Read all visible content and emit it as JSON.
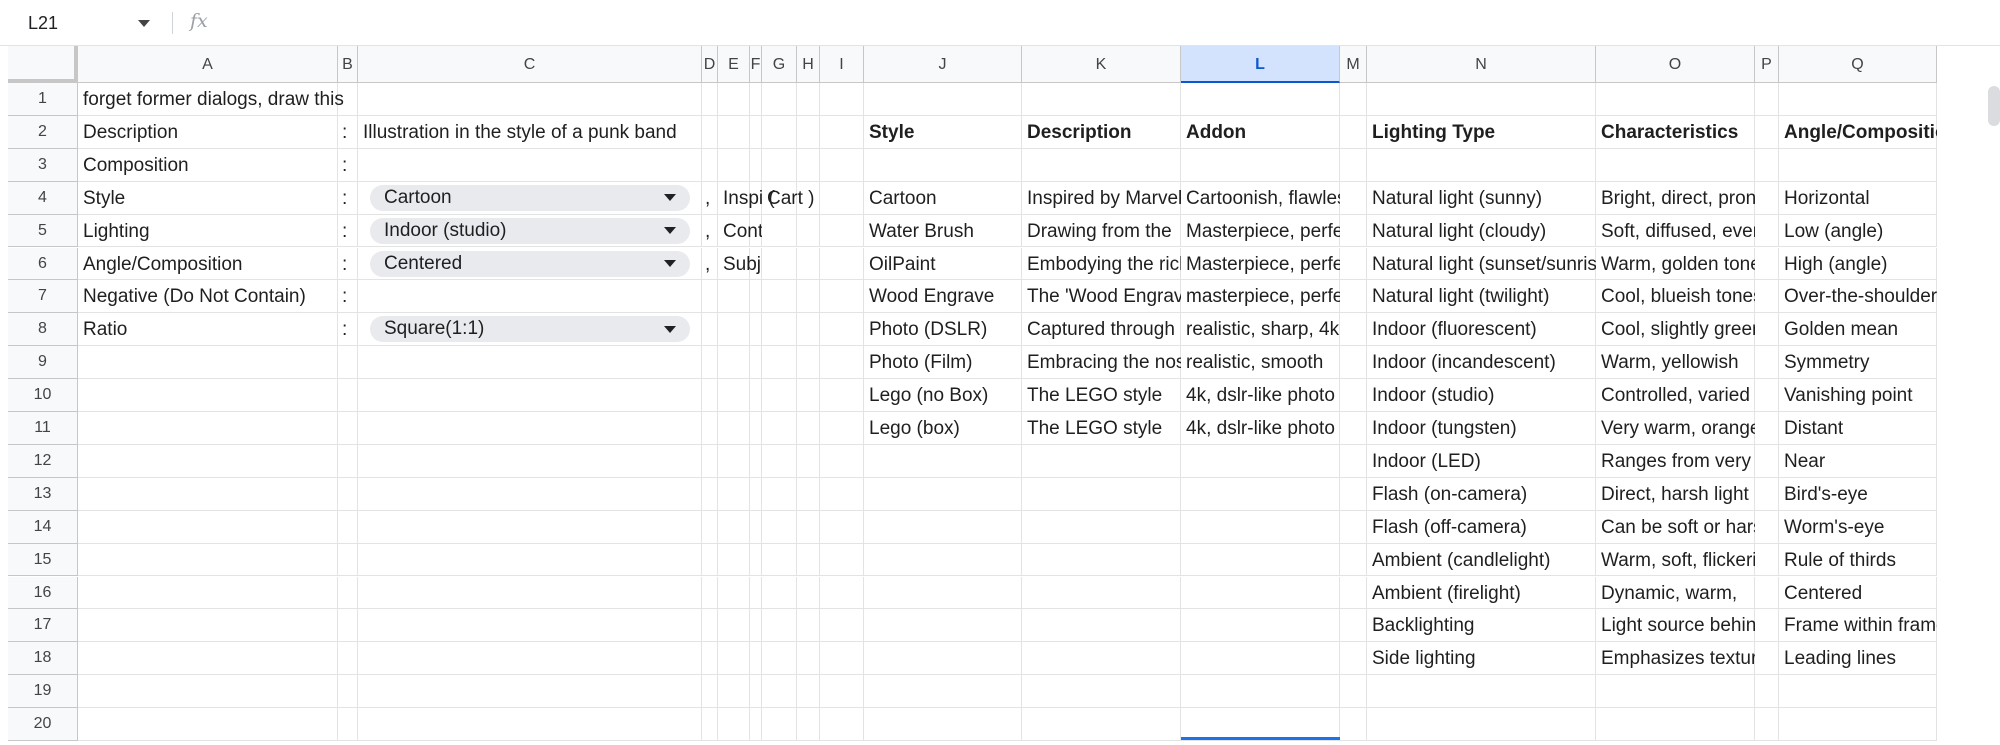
{
  "formula_bar": {
    "cell_ref": "L21",
    "fx_label": "fx",
    "value": ""
  },
  "columns": [
    "A",
    "B",
    "C",
    "D",
    "E",
    "F",
    "G",
    "H",
    "I",
    "J",
    "K",
    "L",
    "M",
    "N",
    "O",
    "P",
    "Q"
  ],
  "selected_column": "L",
  "rows": [
    "1",
    "2",
    "3",
    "4",
    "5",
    "6",
    "7",
    "8",
    "9",
    "10",
    "11",
    "12",
    "13",
    "14",
    "15",
    "16",
    "17",
    "18",
    "19",
    "20"
  ],
  "form": {
    "a1": "forget former dialogs, draw this",
    "labels": [
      "Description",
      "Composition",
      "Style",
      "Lighting",
      "Angle/Composition",
      "Negative (Do Not Contain)",
      "Ratio"
    ],
    "colon": ":",
    "description_value": "Illustration in the style of a punk band",
    "style_value": "Cartoon",
    "lighting_value": "Indoor (studio)",
    "angle_value": "Centered",
    "ratio_value": "Square(1:1)",
    "comma": ",",
    "e4": "Inspi (",
    "g4": "Cart )",
    "e5": "Cont",
    "e6": "Subj"
  },
  "style_table": {
    "headers": [
      "Style",
      "Description",
      "Addon"
    ],
    "rows": [
      [
        "Cartoon",
        "Inspired by Marvel",
        "Cartoonish, flawless"
      ],
      [
        "Water Brush",
        "Drawing from the",
        "Masterpiece, perfect"
      ],
      [
        "OilPaint",
        "Embodying the rich",
        "Masterpiece, perfect"
      ],
      [
        "Wood Engrave",
        "The 'Wood Engraving",
        "masterpiece, perfect"
      ],
      [
        "Photo (DSLR)",
        "Captured through",
        "realistic, sharp, 4k"
      ],
      [
        "Photo (Film)",
        "Embracing the nostalgic",
        "realistic, smooth"
      ],
      [
        "Lego (no Box)",
        "The LEGO style",
        "4k, dslr-like photo"
      ],
      [
        "Lego (box)",
        "The LEGO style",
        "4k, dslr-like photo"
      ]
    ]
  },
  "lighting_table": {
    "headers": [
      "Lighting Type",
      "Characteristics",
      "Angle/Composition"
    ],
    "rows": [
      [
        "Natural light (sunny)",
        "Bright, direct, pronounced",
        "Horizontal"
      ],
      [
        "Natural light (cloudy)",
        "Soft, diffused, even",
        "Low (angle)"
      ],
      [
        "Natural light (sunset/sunrise)",
        "Warm, golden tones",
        "High (angle)"
      ],
      [
        "Natural light (twilight)",
        "Cool, blueish tones",
        "Over-the-shoulder"
      ],
      [
        "Indoor (fluorescent)",
        "Cool, slightly greenish",
        "Golden mean"
      ],
      [
        "Indoor (incandescent)",
        "Warm, yellowish",
        "Symmetry"
      ],
      [
        "Indoor (studio)",
        "Controlled, varied",
        "Vanishing point"
      ],
      [
        "Indoor (tungsten)",
        "Very warm, orange",
        "Distant"
      ],
      [
        "Indoor (LED)",
        "Ranges from very",
        "Near"
      ],
      [
        "Flash (on-camera)",
        "Direct, harsh light",
        "Bird's-eye"
      ],
      [
        "Flash (off-camera)",
        "Can be soft or harsh",
        "Worm's-eye"
      ],
      [
        "Ambient (candlelight)",
        "Warm, soft, flickering",
        "Rule of thirds"
      ],
      [
        "Ambient (firelight)",
        "Dynamic, warm,",
        "Centered"
      ],
      [
        "Backlighting",
        "Light source behind",
        "Frame within frame"
      ],
      [
        "Side lighting",
        "Emphasizes texture",
        "Leading lines"
      ]
    ]
  },
  "colors": {
    "selected_header_bg": "#d3e3fd",
    "selected_header_text": "#0b57d0",
    "chip_bg": "#e8eaed"
  }
}
